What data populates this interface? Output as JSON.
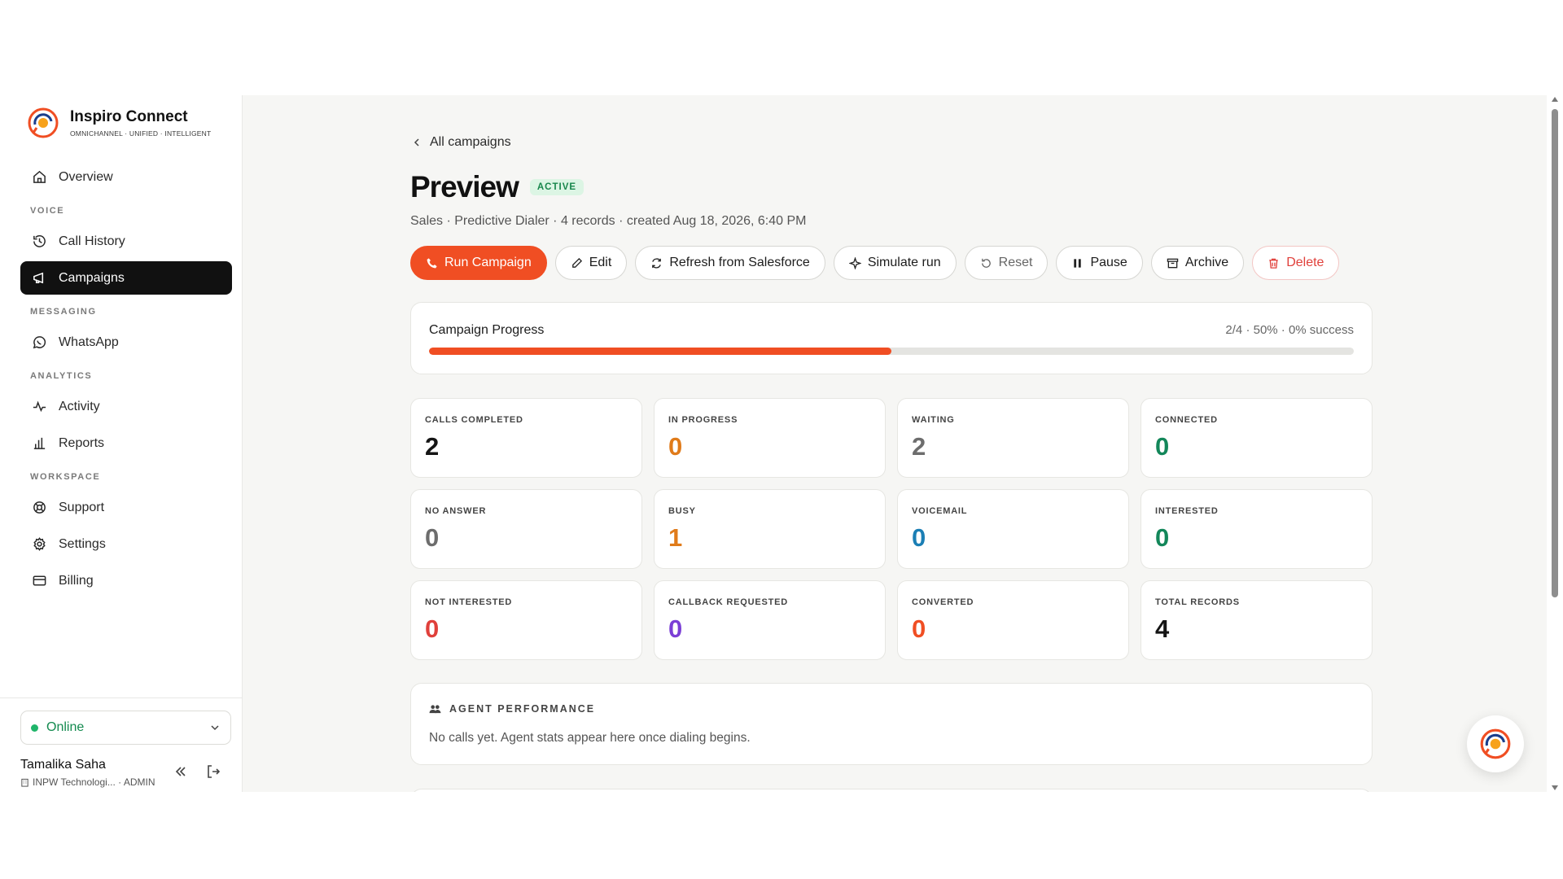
{
  "brand": {
    "name": "Inspiro Connect",
    "tagline": "OMNICHANNEL · UNIFIED · INTELLIGENT"
  },
  "nav": {
    "overview": "Overview",
    "voice_section": "VOICE",
    "call_history": "Call History",
    "campaigns": "Campaigns",
    "messaging_section": "MESSAGING",
    "whatsapp": "WhatsApp",
    "analytics_section": "ANALYTICS",
    "activity": "Activity",
    "reports": "Reports",
    "workspace_section": "WORKSPACE",
    "support": "Support",
    "settings": "Settings",
    "billing": "Billing"
  },
  "status": {
    "label": "Online"
  },
  "user": {
    "name": "Tamalika Saha",
    "org": "INPW Technologi... · ADMIN"
  },
  "page": {
    "back_label": "All campaigns",
    "title": "Preview",
    "status_badge": "ACTIVE",
    "subtitle": "Sales · Predictive Dialer · 4 records · created Aug 18, 2026, 6:40 PM"
  },
  "actions": {
    "run": "Run Campaign",
    "edit": "Edit",
    "refresh": "Refresh from Salesforce",
    "simulate": "Simulate run",
    "reset": "Reset",
    "pause": "Pause",
    "archive": "Archive",
    "delete": "Delete"
  },
  "progress": {
    "label": "Campaign Progress",
    "meta": "2/4 · 50% · 0% success",
    "fraction": 0.5
  },
  "stats": [
    {
      "label": "CALLS COMPLETED",
      "value": "2",
      "color": "#151515"
    },
    {
      "label": "IN PROGRESS",
      "value": "0",
      "color": "#e07b1a"
    },
    {
      "label": "WAITING",
      "value": "2",
      "color": "#6d6d6d"
    },
    {
      "label": "CONNECTED",
      "value": "0",
      "color": "#13875a"
    },
    {
      "label": "NO ANSWER",
      "value": "0",
      "color": "#6d6d6d"
    },
    {
      "label": "BUSY",
      "value": "1",
      "color": "#e07b1a"
    },
    {
      "label": "VOICEMAIL",
      "value": "0",
      "color": "#1b7fb5"
    },
    {
      "label": "INTERESTED",
      "value": "0",
      "color": "#13875a"
    },
    {
      "label": "NOT INTERESTED",
      "value": "0",
      "color": "#e0403b"
    },
    {
      "label": "CALLBACK REQUESTED",
      "value": "0",
      "color": "#7b3fd6"
    },
    {
      "label": "CONVERTED",
      "value": "0",
      "color": "#f04e23"
    },
    {
      "label": "TOTAL RECORDS",
      "value": "4",
      "color": "#151515"
    }
  ],
  "agent_performance": {
    "heading": "AGENT PERFORMANCE",
    "empty_text": "No calls yet. Agent stats appear here once dialing begins."
  },
  "colors": {
    "accent": "#f04e23",
    "active_nav": "#111111",
    "success": "#1fb56a"
  }
}
